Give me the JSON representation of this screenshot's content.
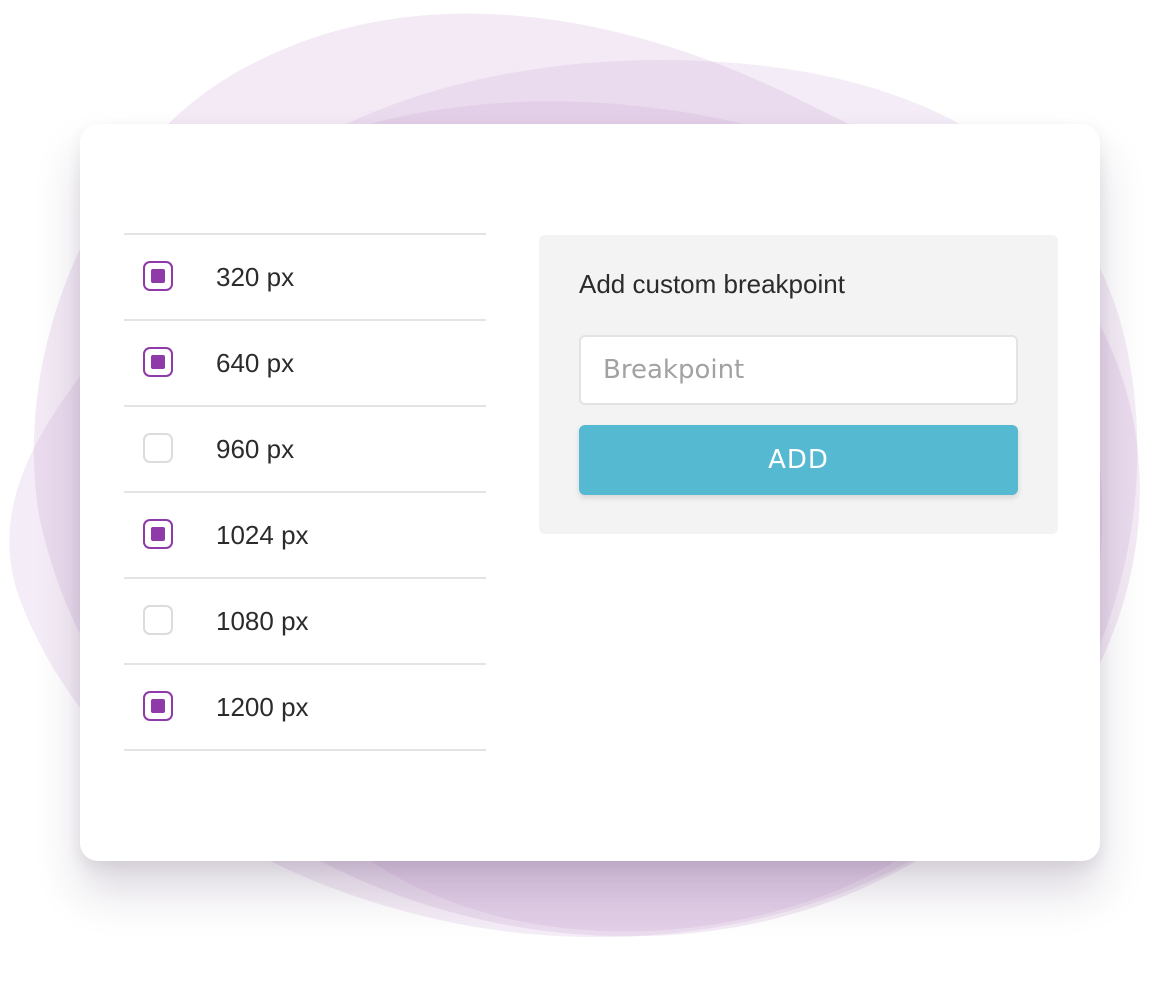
{
  "theme": {
    "accent": "#8e3aa8",
    "button_color": "#55b9d1",
    "backdrop_color": "#c99fd2"
  },
  "breakpoints": [
    {
      "label": "320 px",
      "checked": true
    },
    {
      "label": "640 px",
      "checked": true
    },
    {
      "label": "960 px",
      "checked": false
    },
    {
      "label": "1024 px",
      "checked": true
    },
    {
      "label": "1080 px",
      "checked": false
    },
    {
      "label": "1200 px",
      "checked": true
    }
  ],
  "custom_panel": {
    "title": "Add custom breakpoint",
    "input_placeholder": "Breakpoint",
    "input_value": "",
    "add_label": "ADD"
  }
}
